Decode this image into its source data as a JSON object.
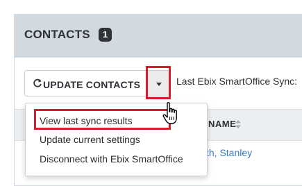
{
  "header": {
    "title": "CONTACTS",
    "count": "1"
  },
  "toolbar": {
    "update_label": "UPDATE CONTACTS",
    "last_sync_label": "Last Ebix SmartOffice Sync:"
  },
  "table": {
    "columns": [
      "NAME"
    ],
    "rows": [
      {
        "name": "th, Stanley"
      }
    ]
  },
  "dropdown_menu": {
    "items": [
      {
        "label": "View last sync results"
      },
      {
        "label": "Update current settings"
      },
      {
        "label": "Disconnect with Ebix SmartOffice"
      }
    ]
  },
  "icons": {
    "refresh": "refresh-icon",
    "caret": "caret-down-icon",
    "sort": "sort-icon",
    "cursor": "hand-pointer-icon"
  },
  "colors": {
    "highlight": "#d4202c",
    "header_band": "#d2d9df",
    "link": "#3a7abf"
  }
}
